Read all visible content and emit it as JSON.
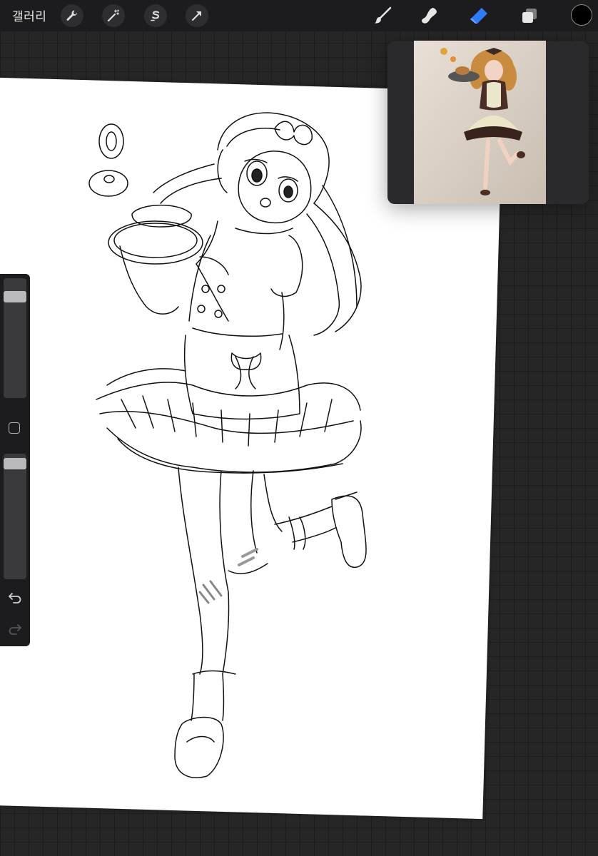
{
  "toolbar": {
    "gallery_label": "갤러리",
    "left_tools": [
      "wrench-icon",
      "magic-wand-icon",
      "selection-s-icon",
      "transform-arrow-icon"
    ],
    "right_tools": [
      "brush-icon",
      "smudge-icon",
      "eraser-icon",
      "layers-icon"
    ],
    "active_tool": "eraser-icon",
    "current_color": "#000000",
    "accent_color": "#2f7bf6"
  },
  "sidebar": {
    "brush_size_level": 0.05,
    "opacity_level": 0.02,
    "modify_button": "square-icon",
    "undo": "undo-icon",
    "redo": "redo-icon"
  },
  "reference_window": {
    "content": "reference-photo"
  }
}
